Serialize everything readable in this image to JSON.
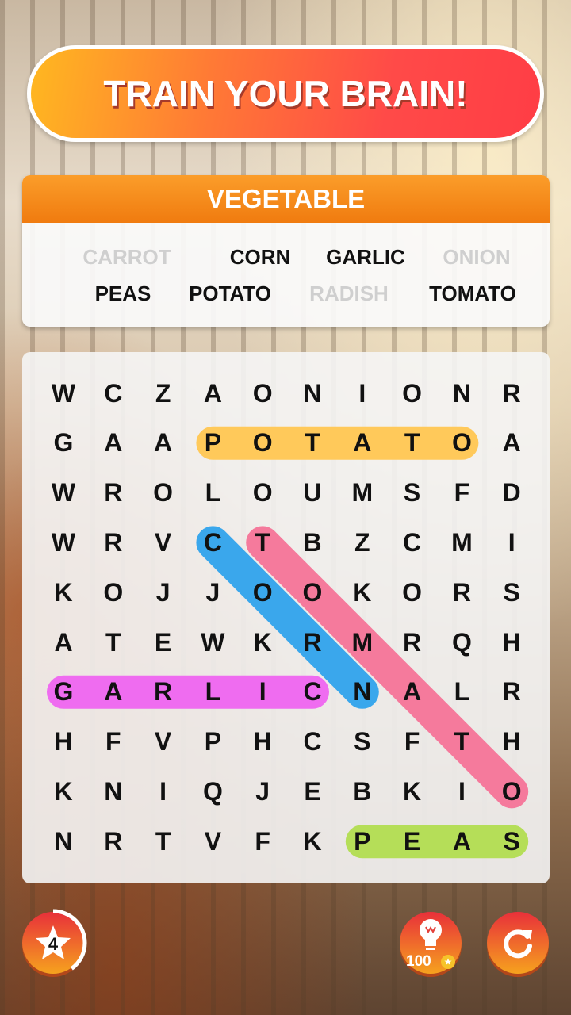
{
  "banner": {
    "title": "TRAIN YOUR BRAIN!"
  },
  "category": {
    "title": "VEGETABLE"
  },
  "words": [
    {
      "text": "CARROT",
      "faded": true
    },
    {
      "text": "CORN",
      "faded": false
    },
    {
      "text": "GARLIC",
      "faded": false
    },
    {
      "text": "ONION",
      "faded": true
    },
    {
      "text": "PEAS",
      "faded": false
    },
    {
      "text": "POTATO",
      "faded": false
    },
    {
      "text": "RADISH",
      "faded": true
    },
    {
      "text": "TOMATO",
      "faded": false
    }
  ],
  "grid": [
    "WCZAONIONR",
    "GAAPOTATOA",
    "WROLOUMSFD",
    "WRVCTBZCMI",
    "KOJJOOKORS",
    "ATEWKRMRQH",
    "GARLICNALR",
    "HFVPHCSFTH",
    "KNIQJEBKIO",
    "NRTVFKPEAS"
  ],
  "highlights": [
    {
      "word": "POTATO",
      "from": [
        1,
        3
      ],
      "to": [
        1,
        8
      ],
      "color": "#ffc95a"
    },
    {
      "word": "CORN",
      "from": [
        3,
        3
      ],
      "to": [
        6,
        6
      ],
      "color": "#3aa7ec"
    },
    {
      "word": "TOMATO",
      "from": [
        3,
        4
      ],
      "to": [
        8,
        9
      ],
      "color": "#f57a9c"
    },
    {
      "word": "GARLIC",
      "from": [
        6,
        0
      ],
      "to": [
        6,
        5
      ],
      "color": "#ef6cf0"
    },
    {
      "word": "PEAS",
      "from": [
        9,
        6
      ],
      "to": [
        9,
        9
      ],
      "color": "#b5de58"
    }
  ],
  "controls": {
    "level": "4",
    "level_progress": 0.4,
    "hint_cost": "100",
    "icons": [
      "star-icon",
      "lightbulb-icon",
      "coin-icon",
      "refresh-icon"
    ]
  }
}
